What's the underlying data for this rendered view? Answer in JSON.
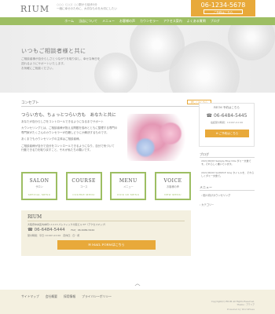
{
  "header": {
    "logo": "RIUM",
    "tagline_line1": "○○○（○○）○○駅から徒歩5分",
    "tagline_line2": "一緒に幸せのために、大切なものを大切にしたい",
    "tel": "06-1234-5678",
    "tel_sub": "ご予約はこちら"
  },
  "nav": {
    "items": [
      "ホーム",
      "当店について",
      "メニュー",
      "お客様の声",
      "カウンセラー",
      "アクセス案内",
      "よくある質問",
      "ブログ"
    ]
  },
  "hero": {
    "title": "いつもご相談者様と共に",
    "text_line1": "ご相談者様が自分らしさとつながりを取り戻し、幸せな毎日を",
    "text_line2": "送れるようにサポートいたします。",
    "text_line3": "お気軽にご相談ください。"
  },
  "about": {
    "section_title": "コンセプト",
    "button": "詳しくはこちら",
    "lead": "つらい方も、ちょっとつらい方も　あなたと共に",
    "body_line1": "あなたが自分らしさをコントロールできるようになるまでサポート",
    "body_line2": "カウンセリングとは、ご相談者様が抱える問題を悩みとともに整理する専門の",
    "body_line3": "専門家がたくさんのカウンセラーが在籍しどうにか解決するものです。",
    "body_line4": "あくまでもカウンセリングの主体はご相談者様。",
    "body_line5": "ご相談者様が自分で自分をコントロールできるようになり、自分で気づいて",
    "body_line6": "行動できる力を取り戻すこと、それが私たちの願いです。"
  },
  "menus": [
    {
      "title": "SALON",
      "jp": "サロン",
      "en": "SPECIAL MENU"
    },
    {
      "title": "COURSE",
      "jp": "コース",
      "en": "COURSE MENU"
    },
    {
      "title": "MENU",
      "jp": "メニュー",
      "en": "PICK UP MENU"
    },
    {
      "title": "VOICE",
      "jp": "お客様の声",
      "en": "NEW MENU"
    }
  ],
  "access": {
    "title": "RIUM",
    "address": "大阪府中央区内本町1-12-13 パシフィック大阪ビル 5F（アクセスマップ）",
    "tel": "06-6484-5444",
    "fax": "FAX：06-6484-5444",
    "hours": "受付時間：平日 10:00〜21:00　定休日：日・祝",
    "button": "MAIL FORMはこちら"
  },
  "sidebar": {
    "label": "RIUM 予約はこちら",
    "tel": "06-6484-5445",
    "hours": "電話受付時間：10:00〜21:00",
    "button": "ご予約はこちら",
    "blog_title": "ブログ",
    "blog_items": [
      "2021/06/03 Sample Blog title ダミー文章です。それらしく書いています。",
      "2021/06/03 SAMPLE blog タイトルを、それらしくダミー文章で。"
    ],
    "menu_title": "メニュー",
    "menu_link": "個人向けカウンセリング",
    "category": "カテゴリー"
  },
  "footer": {
    "to_top": "︿",
    "links": [
      "サイトマップ",
      "会社概要",
      "採用情報",
      "プライバシーポリシー"
    ],
    "copyright_line1": "Copyright(C) RIUM All Rights Reserved.",
    "copyright_line2": "Theme : アテリア",
    "credit": "Powered by WordPress"
  }
}
